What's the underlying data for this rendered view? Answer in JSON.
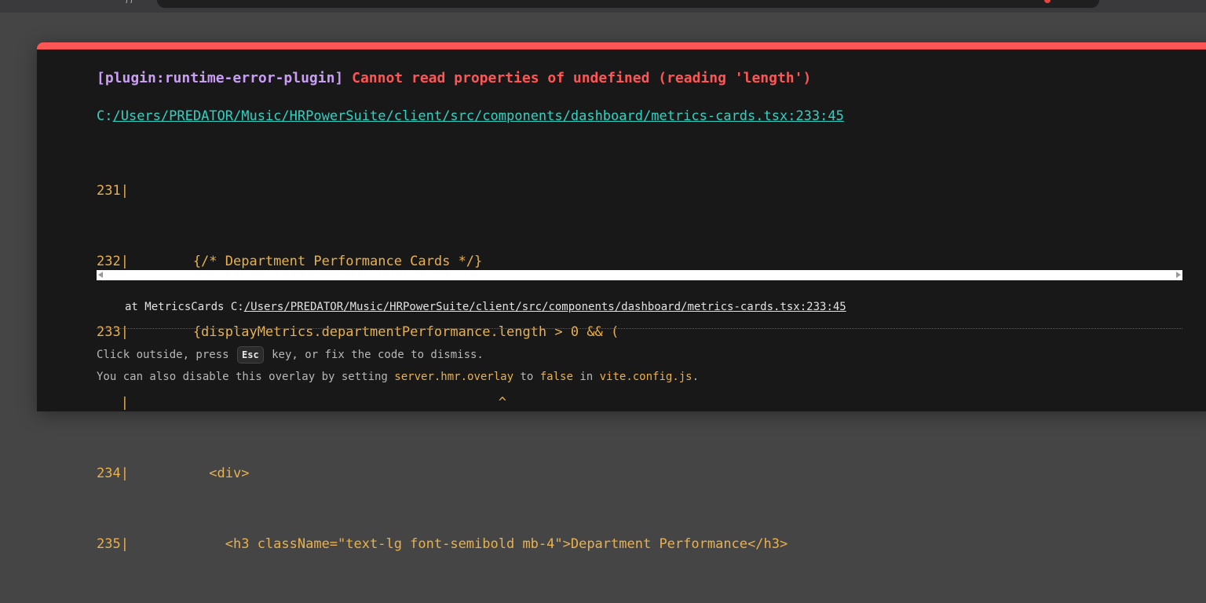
{
  "browser": {
    "toolbar_glyph": "))"
  },
  "overlay": {
    "plugin": "[plugin:runtime-error-plugin]",
    "message": "Cannot read properties of undefined (reading 'length')",
    "file": {
      "drive": "C:",
      "path": "/Users/PREDATOR/Music/HRPowerSuite/client/src/components/dashboard/metrics-cards.tsx:233:45"
    },
    "frame": [
      "231|",
      "232|        {/* Department Performance Cards */}",
      "233|        {displayMetrics.departmentPerformance.length > 0 && (",
      "   |                                              ^",
      "234|          <div>",
      "235|            <h3 className=\"text-lg font-semibold mb-4\">Department Performance</h3>"
    ],
    "stack": {
      "prefix": "at MetricsCards C:",
      "path": "/Users/PREDATOR/Music/HRPowerSuite/client/src/components/dashboard/metrics-cards.tsx:233:45"
    },
    "tip": {
      "line1_before": "Click outside, press ",
      "key": "Esc",
      "line1_after": " key, or fix the code to dismiss.",
      "line2_a": "You can also disable this overlay by setting ",
      "code_setting": "server.hmr.overlay",
      "line2_b": " to ",
      "code_false": "false",
      "line2_c": " in ",
      "code_file": "vite.config.js",
      "line2_d": "."
    }
  },
  "colors": {
    "accent_border": "#ff5555",
    "plugin": "#cb9ef6",
    "file_link": "#2dd4c4",
    "code": "#e8b14f",
    "background": "#181818"
  }
}
